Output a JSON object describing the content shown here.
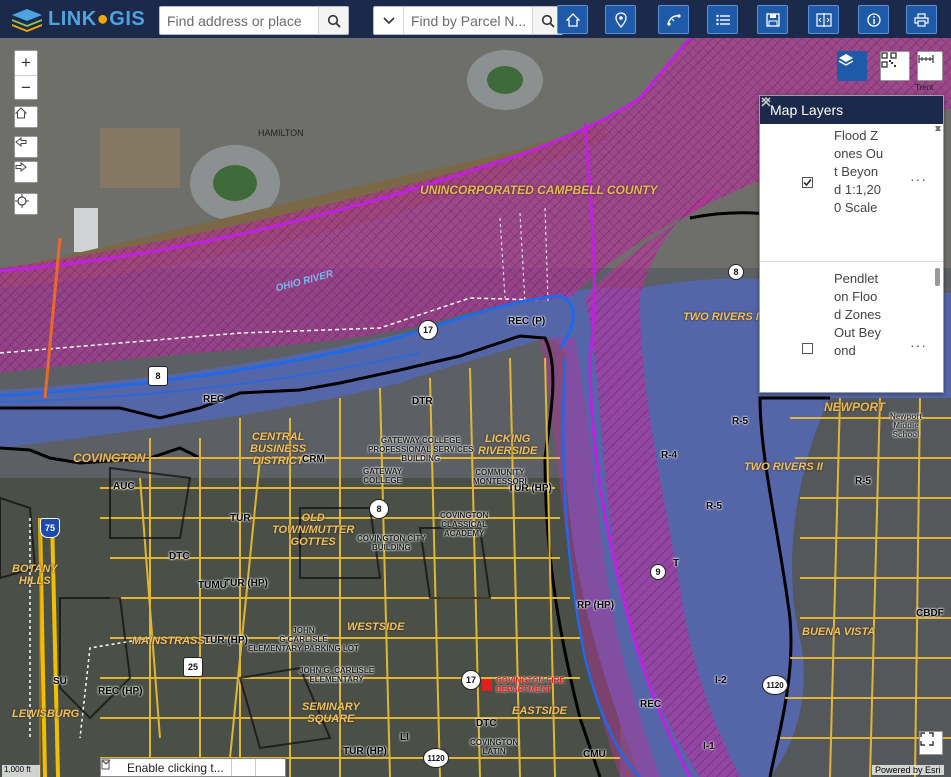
{
  "app": {
    "brand_link": "LINK",
    "brand_gis": "GIS",
    "address_search": {
      "placeholder": "Find address or place"
    },
    "parcel_search": {
      "placeholder": "Find by Parcel N..."
    },
    "tools": [
      "home-icon",
      "location-pin-icon",
      "measure-icon",
      "list-icon",
      "save-icon",
      "compare-icon",
      "info-icon",
      "print-icon"
    ]
  },
  "map": {
    "labels": {
      "county": "UNINCORPORATED CAMPBELL COUNTY",
      "ohio_river": "OHIO RIVER",
      "hamilton": "HAMILTON",
      "covington": "COVINGTON",
      "newport": "NEWPORT",
      "central_business": "CENTRAL\nBUSINESS\nDISTRICT",
      "licking_riverside": "LICKING\nRIVERSIDE",
      "old_town": "OLD\nTOWN/MUTTER\nGOTTES",
      "botany_hills": "BOTANY\nHILLS",
      "mainstrasse": "MAINSTRASSE",
      "westside": "WESTSIDE",
      "seminary_square": "SEMINARY\nSQUARE",
      "eastside": "EASTSIDE",
      "lewisburg": "LEWISBURG",
      "two_rivers_1": "TWO RIVERS I",
      "two_rivers_2": "TWO RIVERS II",
      "buena_vista": "BUENA VISTA",
      "trent": "Trent"
    },
    "zones": {
      "rec_p": "REC (P)",
      "rec": "REC",
      "dtr": "DTR",
      "crm": "CRM",
      "auc": "AUC",
      "tur": "TUR",
      "tur_hp": "TUR (HP)",
      "tur_hp2": "TUR (HP)",
      "tur_hp3": "TUR (HP)",
      "tur_hp4": "TUR (HP)",
      "dtc": "DTC",
      "tumu": "TUMU",
      "su": "SU",
      "rec_hp": "REC (HP)",
      "rp_hp": "RP (HP)",
      "r4": "R-4",
      "r5": "R-5",
      "r5b": "R-5",
      "i2": "I-2",
      "i1": "I-1",
      "cmu": "CMU",
      "li": "LI",
      "cbdf": "CBDF",
      "t": "T",
      "dtc2": "DTC",
      "rec2": "REC",
      "r5c": "R-5"
    },
    "buildings": {
      "gateway_prof": "GATEWAY COLLEGE\nPROFESSIONAL SERVICES\nBUILDING",
      "gateway_college": "GATEWAY\nCOLLEGE",
      "community_montessori": "COMMUNITY\nMONTESSORI",
      "covington_classical": "COVINGTON\nCLASSICAL\nACADEMY",
      "city_building": "COVINGTON CITY\nBUILDING",
      "carlisle_parking": "JOHN\nG CARLISLE\nELEMENTARY PARKING LOT",
      "carlisle_elem": "JOHN G. CARLISLE\nELEMENTARY",
      "fire_dept": "COVINGTON FIRE\nDEPARTMENT",
      "covington_latin": "COVINGTON\nLATIN",
      "newport_middle": "Newport\nMiddle\nSchool"
    },
    "shields": {
      "us8": "8",
      "r17": "17",
      "r17b": "17",
      "r8": "8",
      "i75": "75",
      "r25": "25",
      "r1120": "1120",
      "r1120b": "1120",
      "r9": "9",
      "r8b": "8"
    },
    "scale_text": "1,000 ft"
  },
  "layers_panel": {
    "title": "Map Layers",
    "layers": [
      {
        "name": "Flood Zones Out Beyond 1:1,200 Scale",
        "checked": true
      },
      {
        "name": "Pendleton Flood Zones Out Beyond",
        "checked": false
      }
    ],
    "more_label": "···"
  },
  "bottom": {
    "enable_text": "Enable clicking t...",
    "powered": "Powered by Esri"
  }
}
